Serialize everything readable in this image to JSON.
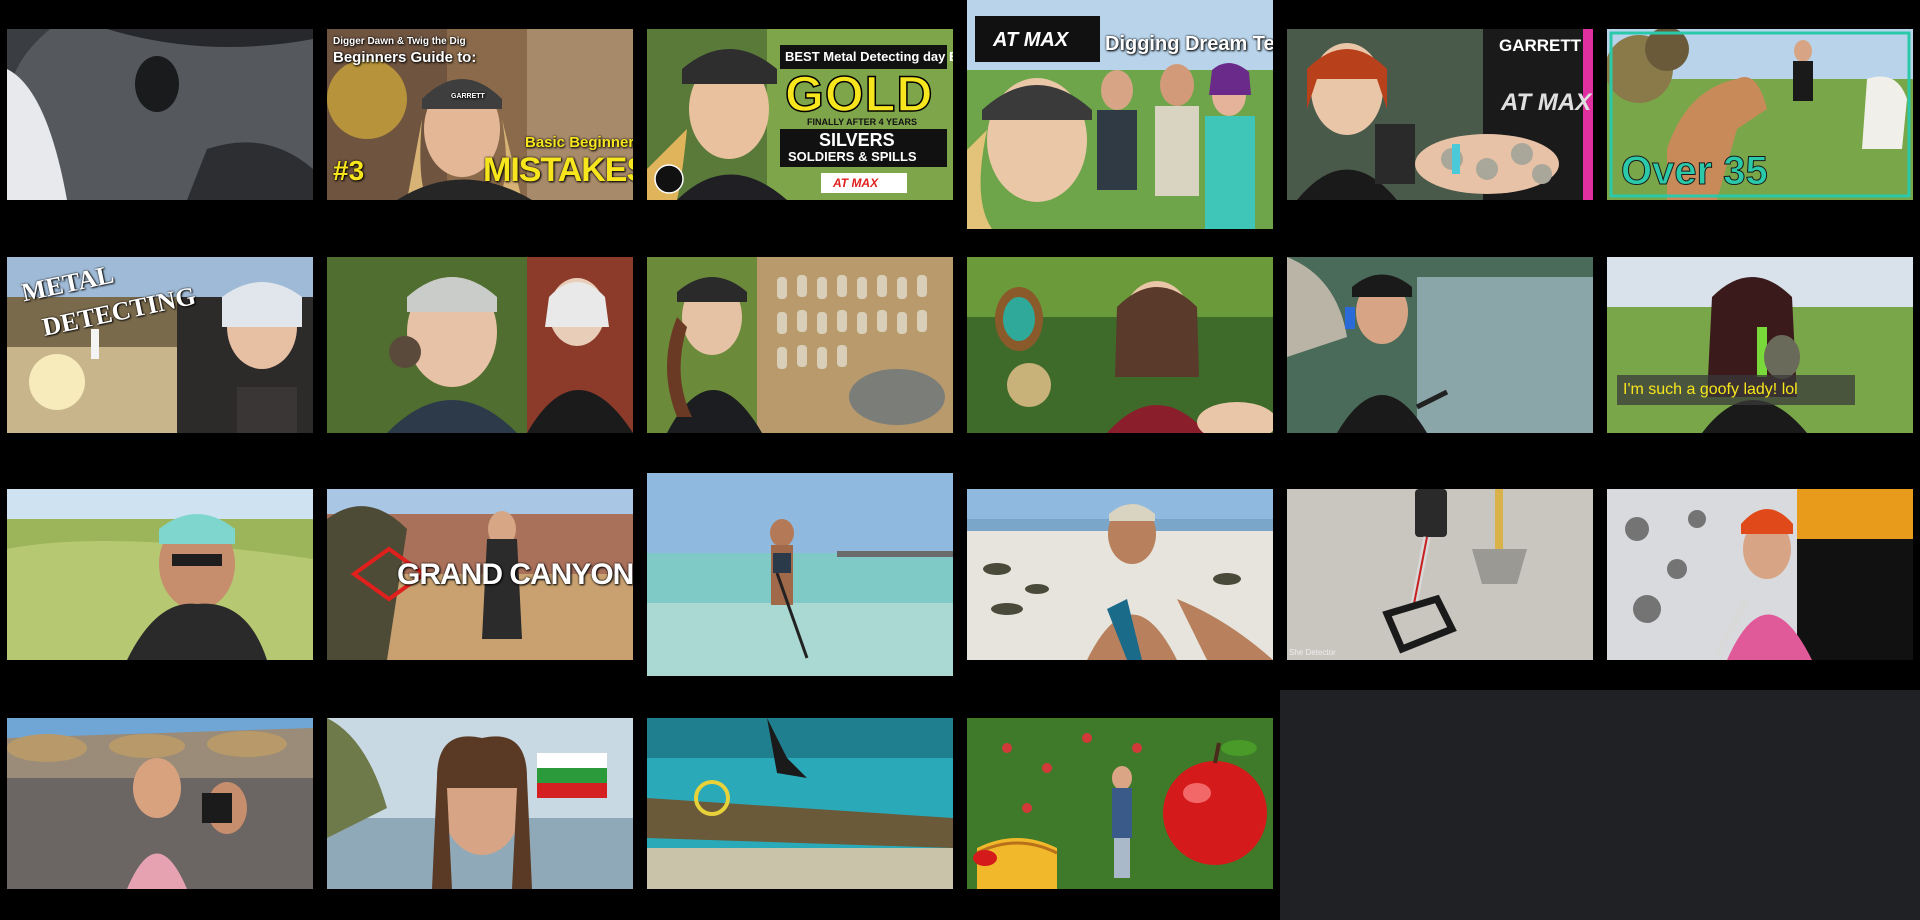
{
  "thumbnails": [
    {
      "id": 1
    },
    {
      "id": 2,
      "texts": {
        "series": "Digger Dawn & Twig the Dig",
        "title": "Beginners Guide to:",
        "subtitle": "Basic Beginner",
        "number": "#3",
        "big": "MISTAKES",
        "logo": "GARRETT"
      }
    },
    {
      "id": 3,
      "texts": {
        "banner": "BEST Metal Detecting day EVER",
        "big": "GOLD",
        "sub": "FINALLY AFTER 4 YEARS",
        "box1": "SILVERS",
        "box2": "SOLDIERS & SPILLS",
        "brand": "AT MAX"
      }
    },
    {
      "id": 4,
      "texts": {
        "brand": "AT MAX",
        "title": "Digging Dream Team"
      }
    },
    {
      "id": 5,
      "texts": {
        "brand": "GARRETT",
        "model": "AT MAX"
      }
    },
    {
      "id": 6,
      "texts": {
        "title": "Over 35"
      }
    },
    {
      "id": 7,
      "texts": {
        "title1": "METAL",
        "title2": "DETECTING"
      }
    },
    {
      "id": 8
    },
    {
      "id": 9
    },
    {
      "id": 10
    },
    {
      "id": 11
    },
    {
      "id": 12,
      "texts": {
        "caption": "I'm such a goofy lady! lol"
      }
    },
    {
      "id": 13
    },
    {
      "id": 14,
      "texts": {
        "title": "GRAND CANYON"
      }
    },
    {
      "id": 15
    },
    {
      "id": 16
    },
    {
      "id": 17,
      "texts": {
        "credit": "She Detector"
      }
    },
    {
      "id": 18
    },
    {
      "id": 19
    },
    {
      "id": 20
    },
    {
      "id": 21
    },
    {
      "id": 22
    }
  ],
  "colors": {
    "page_background": "#202124",
    "column_background": "#000000",
    "accent_yellow": "#f7e51d",
    "accent_red": "#e0201c"
  }
}
